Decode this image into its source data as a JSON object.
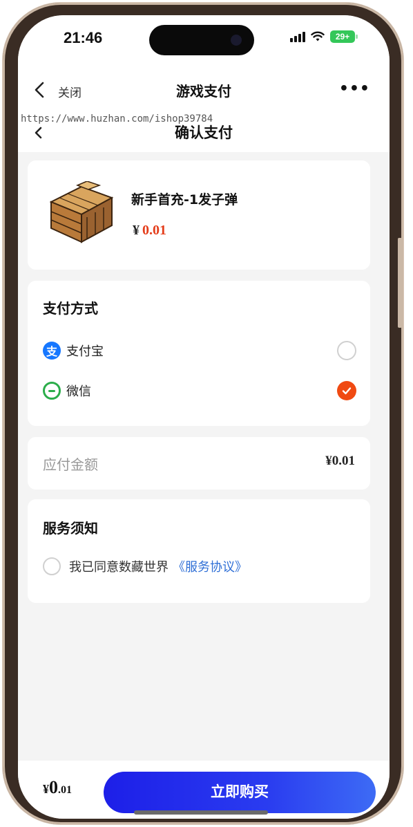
{
  "status_bar": {
    "time": "21:46",
    "battery": "29+"
  },
  "nav": {
    "close_label": "关闭",
    "title": "游戏支付",
    "more_label": "•••"
  },
  "page": {
    "watermark": "https://www.huzhan.com/ishop39784",
    "title": "确认支付"
  },
  "product": {
    "name": "新手首充-1发子弹",
    "currency": "¥",
    "price": "0.01"
  },
  "payment": {
    "section_title": "支付方式",
    "methods": [
      {
        "label": "支付宝",
        "icon": "alipay-icon",
        "selected": false
      },
      {
        "label": "微信",
        "icon": "wechat-icon",
        "selected": true
      }
    ]
  },
  "amount": {
    "label": "应付金额",
    "value": "¥0.01"
  },
  "notice": {
    "section_title": "服务须知",
    "agree_text": "我已同意数藏世界",
    "agreement_link": "《服务协议》"
  },
  "bottom": {
    "currency": "¥",
    "integer": "0",
    "decimal": ".01",
    "buy_label": "立即购买"
  },
  "colors": {
    "accent_red": "#f04a12",
    "price_red": "#e43d1b",
    "link_blue": "#2f6fd6",
    "button_blue": "#1d1fe8",
    "alipay_blue": "#1677ff",
    "wechat_green": "#2bad4a"
  }
}
